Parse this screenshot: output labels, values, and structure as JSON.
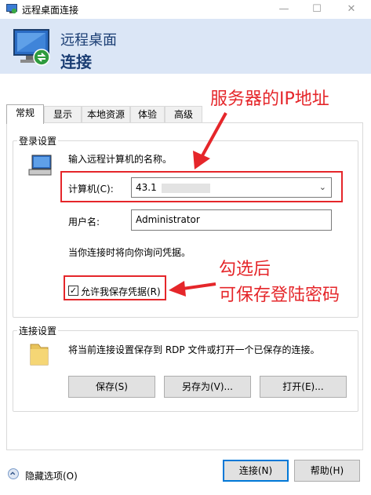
{
  "window": {
    "title": "远程桌面连接",
    "min_glyph": "—",
    "max_glyph": "☐",
    "close_glyph": "✕"
  },
  "header": {
    "line1": "远程桌面",
    "line2": "连接"
  },
  "annotations": {
    "server_ip": "服务器的IP地址",
    "save_hint_1": "勾选后",
    "save_hint_2": "可保存登陆密码",
    "color": "#e5262a"
  },
  "tabs": [
    {
      "label": "常规",
      "active": true
    },
    {
      "label": "显示"
    },
    {
      "label": "本地资源"
    },
    {
      "label": "体验"
    },
    {
      "label": "高级"
    }
  ],
  "login": {
    "group_label": "登录设置",
    "prompt": "输入远程计算机的名称。",
    "computer_label": "计算机(C):",
    "computer_value": "43.1",
    "username_label": "用户名:",
    "username_value": "Administrator",
    "credentials_note": "当你连接时将向你询问凭据。",
    "save_credentials_label": "允许我保存凭据(R)",
    "save_credentials_checked": true
  },
  "connection": {
    "group_label": "连接设置",
    "description": "将当前连接设置保存到 RDP 文件或打开一个已保存的连接。",
    "save_button": "保存(S)",
    "save_as_button": "另存为(V)...",
    "open_button": "打开(E)..."
  },
  "footer": {
    "hide_options": "隐藏选项(O)",
    "connect_button": "连接(N)",
    "help_button": "帮助(H)"
  }
}
